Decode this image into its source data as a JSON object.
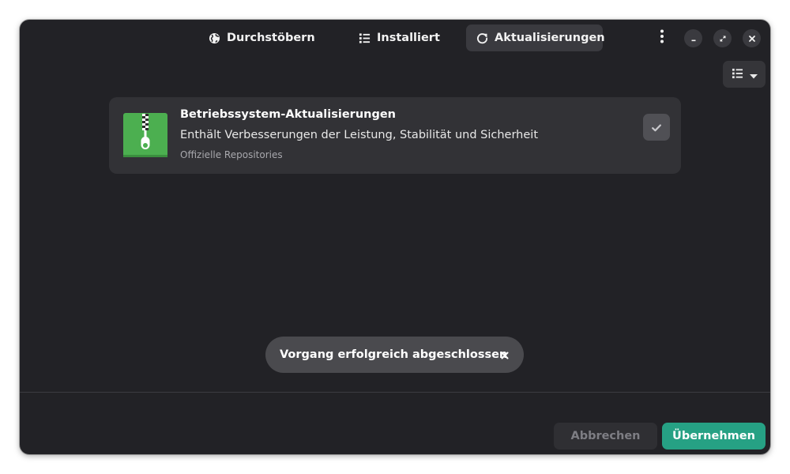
{
  "header": {
    "tabs": [
      {
        "label": "Durchstöbern",
        "icon": "globe-icon",
        "active": false
      },
      {
        "label": "Installiert",
        "icon": "list-icon",
        "active": false
      },
      {
        "label": "Aktualisierungen",
        "icon": "refresh-icon",
        "active": true
      }
    ],
    "menu_icon": "kebab-menu-icon",
    "window_controls": [
      "minimize-icon",
      "maximize-icon",
      "close-icon"
    ]
  },
  "toolbar": {
    "view_toggle_icons": [
      "list-view-icon",
      "chevron-down-icon"
    ]
  },
  "update_card": {
    "title": "Betriebssystem-Aktualisierungen",
    "description": "Enthält Verbesserungen der Leistung, Stabilität und Sicherheit",
    "source": "Offizielle Repositories",
    "icon": "archive-zipper-icon",
    "checked": true
  },
  "toast": {
    "message": "Vorgang erfolgreich abgeschlossen"
  },
  "footer": {
    "cancel_label": "Abbrechen",
    "apply_label": "Übernehmen"
  },
  "colors": {
    "window_bg": "#222226",
    "card_bg": "#323236",
    "accent": "#26a184",
    "icon_green": "#4caf50"
  }
}
